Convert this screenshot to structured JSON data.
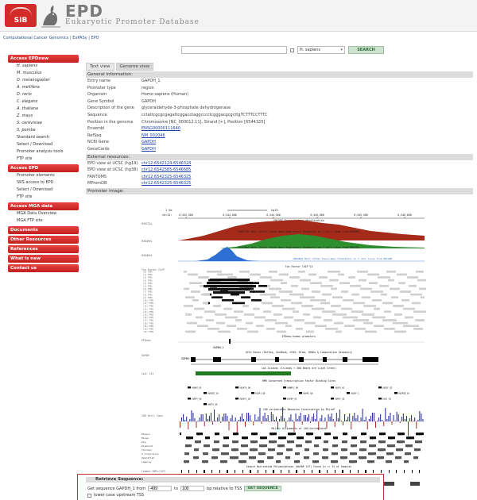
{
  "header": {
    "logo_text": "SIB",
    "title": "EPD",
    "subtitle": "Eukaryotic Promoter Database"
  },
  "breadcrumb": {
    "items": [
      "Computational Cancer Genomics",
      "ExPASy",
      "EPD"
    ]
  },
  "search": {
    "query": "",
    "species": "H. sapiens",
    "button": "SEARCH"
  },
  "sidebar": {
    "groups": [
      {
        "title": "Access EPDnew",
        "items": [
          {
            "label": "H. sapiens",
            "italic": true
          },
          {
            "label": "M. musculus",
            "italic": true
          },
          {
            "label": "D. melanogaster",
            "italic": true
          },
          {
            "label": "A. mellifera",
            "italic": true
          },
          {
            "label": "D. rerio",
            "italic": true
          },
          {
            "label": "C. elegans",
            "italic": true
          },
          {
            "label": "A. thaliana",
            "italic": true
          },
          {
            "label": "Z. mays",
            "italic": true
          },
          {
            "label": "S. cerevisiae",
            "italic": true
          },
          {
            "label": "S. pombe",
            "italic": true
          },
          {
            "label": "Standard search",
            "italic": false
          },
          {
            "label": "Select / Download",
            "italic": false
          },
          {
            "label": "Promoter analysis tools",
            "italic": false
          },
          {
            "label": "FTP site",
            "italic": false
          }
        ]
      },
      {
        "title": "Access EPD",
        "items": [
          {
            "label": "Promoter elements",
            "italic": false
          },
          {
            "label": "SRS access to EPD",
            "italic": false
          },
          {
            "label": "Select / Download",
            "italic": false
          },
          {
            "label": "FTP site",
            "italic": false
          }
        ]
      },
      {
        "title": "Access MGA data",
        "items": [
          {
            "label": "MGA Data Overview",
            "italic": false
          },
          {
            "label": "MGA FTP site",
            "italic": false
          }
        ]
      },
      {
        "title": "Documents",
        "items": []
      },
      {
        "title": "Other Resources",
        "items": []
      },
      {
        "title": "References",
        "items": []
      },
      {
        "title": "What is new",
        "items": []
      },
      {
        "title": "Contact us",
        "items": []
      }
    ]
  },
  "tabs": [
    {
      "label": "Text view",
      "active": false
    },
    {
      "label": "Genome view",
      "active": true
    }
  ],
  "general": {
    "title": "General information:",
    "rows": [
      {
        "label": "Entry name",
        "value": "GAPDH_1",
        "link": false
      },
      {
        "label": "Promoter type",
        "value": "region",
        "link": false
      },
      {
        "label": "Organism",
        "value": "Homo sapiens (Human)",
        "link": false
      },
      {
        "label": "Gene Symbol",
        "value": "GAPDH",
        "link": false
      },
      {
        "label": "Description of the gene",
        "value": "glyceraldehyde-3-phosphate dehydrogenase",
        "link": false
      },
      {
        "label": "Sequence",
        "value": "cctattcgcgcgagattcggacctaggcccctcgggacgcgcttgTCTTTCCTTTC",
        "link": false
      },
      {
        "label": "Position in the genome",
        "value": "Chromosome [NC_000012.11], Strand [+], Position [6544325]",
        "link": false
      },
      {
        "label": "Ensembl",
        "value": "ENSG00000111640",
        "link": true
      },
      {
        "label": "RefSeq",
        "value": "NM_002046",
        "link": true
      },
      {
        "label": "NCBI Gene",
        "value": "GAPDH",
        "link": true
      },
      {
        "label": "GeneCards",
        "value": "GAPDH",
        "link": true
      }
    ]
  },
  "external": {
    "title": "External resources:",
    "rows": [
      {
        "label": "EPD view at UCSC (hg19)",
        "value": "chr12:6542124-6546324"
      },
      {
        "label": "EPD view at UCSC (hg38)",
        "value": "chr12:6542585-6546685"
      },
      {
        "label": "FANTOM5",
        "value": "chr12:6542325-6546325"
      },
      {
        "label": "MPromDB",
        "value": "chr12:6542325-6546325"
      }
    ]
  },
  "promoter_image": {
    "title": "Promoter image:",
    "scale_left": "1 kb",
    "scale_right": "hg19",
    "coords": [
      "6,543,500",
      "6,544,000",
      "6,544,500",
      "6,545,000",
      "6,545,500",
      "6,546,000"
    ],
    "chrom_label": "chr12:",
    "track_labels": [
      "ENCODE Broad Histone Modification",
      "H3K27Ac Mark (Often Found Near Regulatory Elements) on 7 cell lines from ENCODE",
      "H3K4Me1 Mark (Often Found Near Regulatory Elements) on 7 cell lines from ENCODE",
      "H3K4Me3 Mark (Often Found Near Promoters) on 7 cell lines from ENCODE",
      "Txn Factor ChIP V3",
      "EPDnew human promoters",
      "UCSC Genes (RefSeq, GenBank, CCDS, Rfam, tRNAs & Comparative Genomics)",
      "CpG Islands (Islands < 300 Bases are Light Green)",
      "HMR Conserved Transcription Factor Binding Sites",
      "100 vertebrates Basewise Conservation by PhyloP",
      "Multiz Alignments of 100 Vertebrates",
      "Simple Nucleotide Polymorphisms (dbSNP 147) Found in >= 1% of Samples",
      "Repeating Elements by RepeatMasker"
    ],
    "side_labels": [
      "H3K27Ac",
      "H3K4Me1",
      "H3K4Me3",
      "Txn Factor ChIP",
      "EPDnew",
      "GAPDH",
      "CpG: 141",
      "100 Vert. Cons",
      "Rhesus",
      "Mouse",
      "Dog",
      "Elephant",
      "Chicken",
      "X_tropicalis",
      "Zebrafish",
      "Lamprey",
      "Common SNPs(147)",
      "RepeatMasker"
    ],
    "gene_labels": [
      "GAPDH_1",
      "GAPDH"
    ],
    "tfbs_labels": [
      "V$MAZ_01",
      "V$GATA_Q6",
      "V$NRF1_Q6",
      "V$SP1_01",
      "V$E2F_Q2",
      "V$EGR1_01",
      "V$SP1_Q6",
      "V$AP2_Q6",
      "V$USF_C",
      "V$CREB_01",
      "V$NFY_Q6",
      "V$HIF1_Q5",
      "V$TBP_01",
      "V$MYC_Q2",
      "V$GC_01",
      "V$ETS_Q4"
    ]
  },
  "retrieve": {
    "title": "Retrieve Sequence:",
    "label_prefix": "Get sequence GAPDH_1 from",
    "from_value": "-499",
    "to_label": "to",
    "to_value": "100",
    "suffix": "bp relative to TSS",
    "button": "GET SEQUENCE",
    "checkbox_label": "lower case upstream TSS"
  },
  "colors": {
    "accent_red": "#d32a2a",
    "track_red": "#a52a1a",
    "track_green": "#2f8f2f",
    "track_blue": "#2f6fd3",
    "link_blue": "#1b3fa8"
  }
}
